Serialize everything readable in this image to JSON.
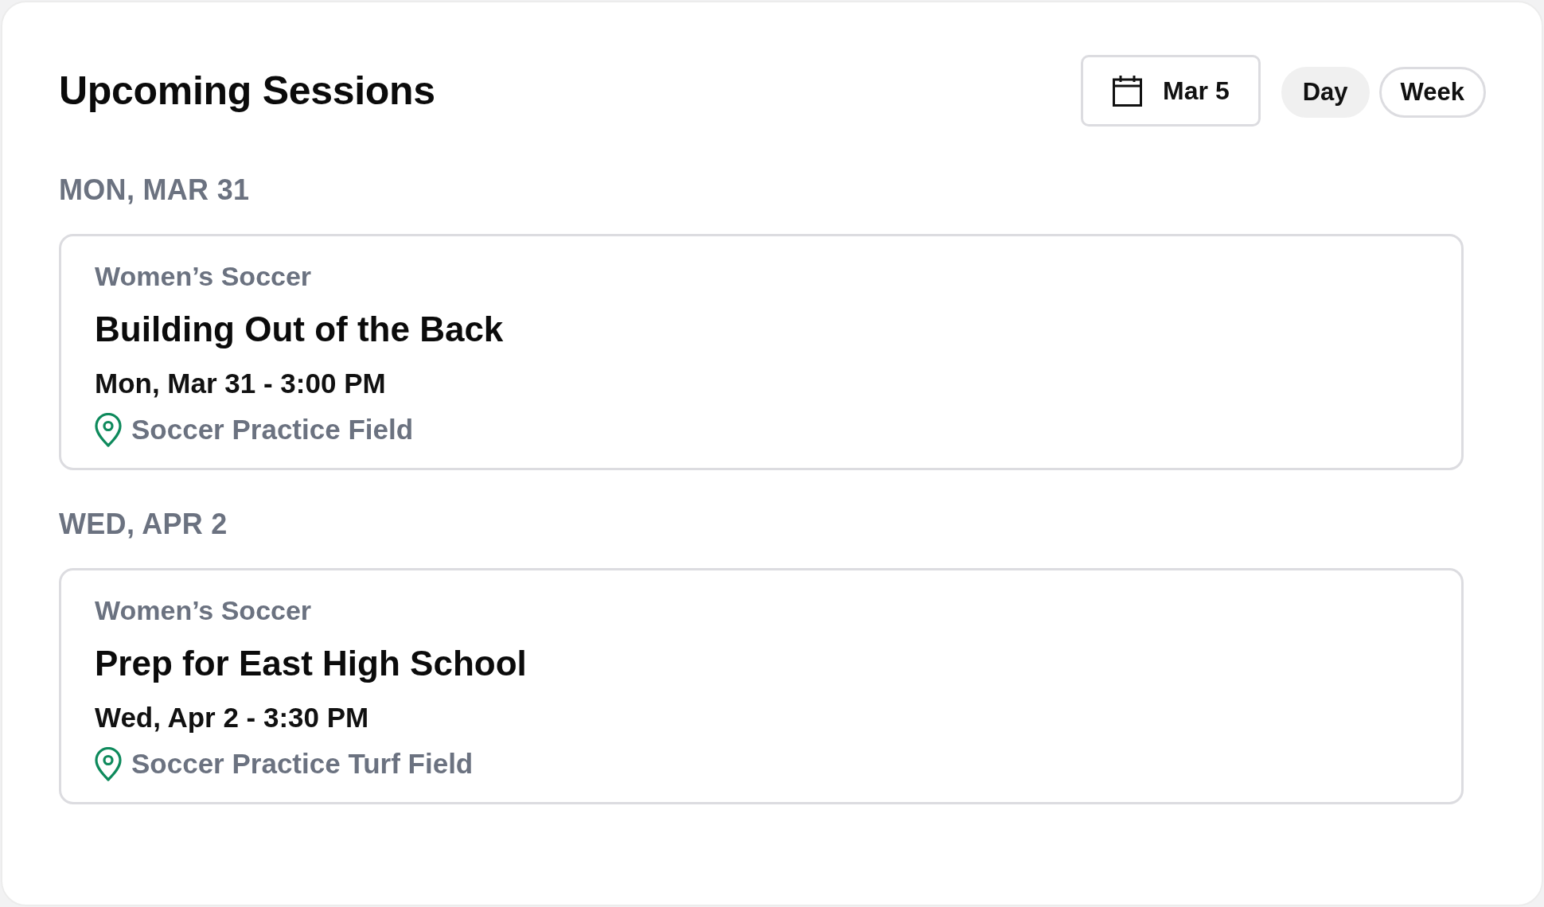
{
  "panel": {
    "title": "Upcoming Sessions"
  },
  "date_picker": {
    "value": "Mar 5"
  },
  "view_toggle": [
    {
      "label": "Day",
      "selected": true
    },
    {
      "label": "Week",
      "selected": false
    }
  ],
  "days": [
    {
      "heading": "MON, MAR 31",
      "sessions": [
        {
          "team": "Women’s Soccer",
          "title": "Building Out of the Back",
          "time": "Mon, Mar 31 - 3:00 PM",
          "location": "Soccer Practice Field"
        }
      ]
    },
    {
      "heading": "WED, APR 2",
      "sessions": [
        {
          "team": "Women’s Soccer",
          "title": "Prep for East High School",
          "time": "Wed, Apr 2 - 3:30 PM",
          "location": "Soccer Practice Turf Field"
        }
      ]
    }
  ]
}
